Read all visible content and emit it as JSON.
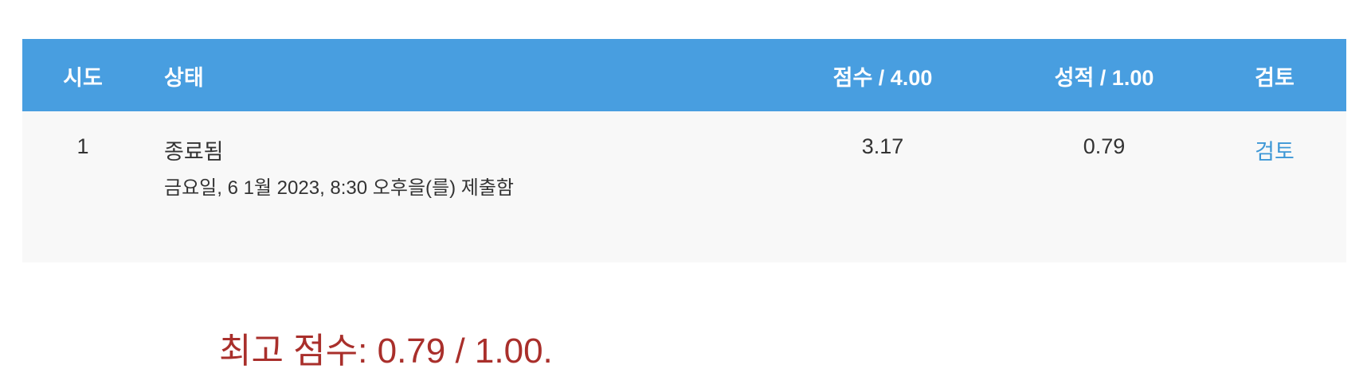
{
  "table": {
    "headers": {
      "attempt": "시도",
      "status": "상태",
      "score": "점수 / 4.00",
      "grade": "성적 / 1.00",
      "review": "검토"
    },
    "rows": [
      {
        "attempt": "1",
        "status": "종료됨",
        "submitted": "금요일, 6 1월 2023, 8:30 오후을(를) 제출함",
        "score": "3.17",
        "grade": "0.79",
        "review_link": "검토"
      }
    ]
  },
  "summary": {
    "best_score": "최고 점수: 0.79 / 1.00."
  },
  "colors": {
    "header_bg": "#489ee0",
    "row_bg": "#f8f8f8",
    "link": "#3d97d6",
    "best_score": "#a92f2b"
  }
}
